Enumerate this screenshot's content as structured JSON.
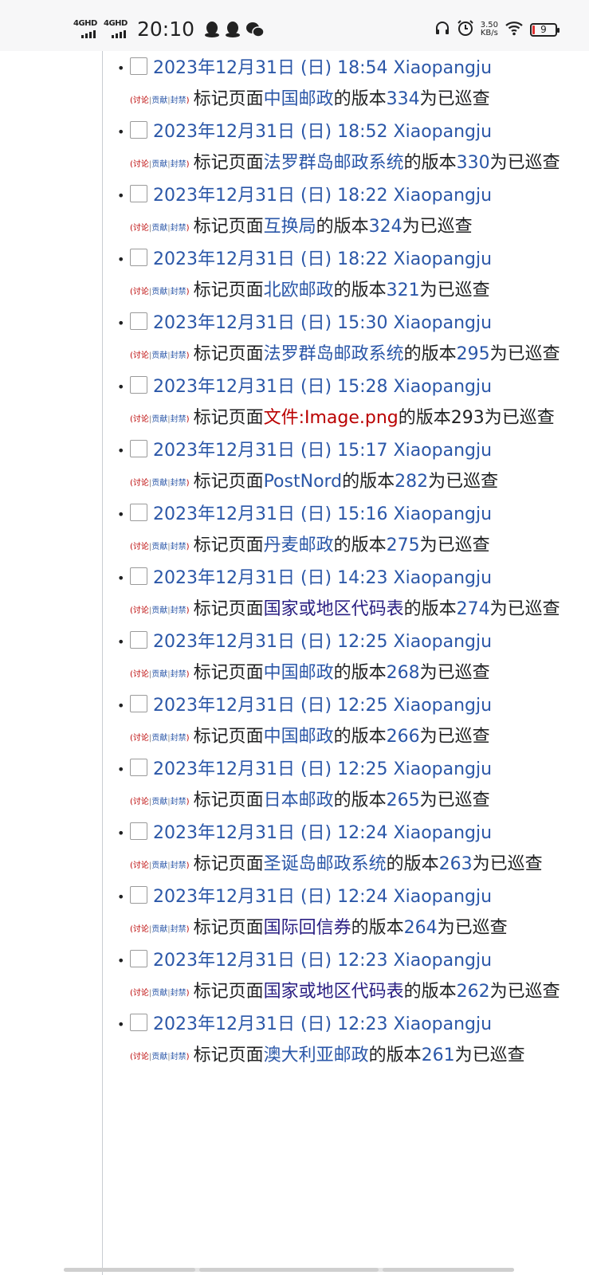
{
  "status_bar": {
    "signal1_label": "4GHD",
    "signal2_label": "4GHD",
    "time": "20:10",
    "notification_icons": [
      "qq-penguin-icon",
      "qq-penguin-icon",
      "wechat-icon"
    ],
    "net_speed_value": "3.50",
    "net_speed_unit": "KB/s",
    "battery_level": "9"
  },
  "tools": {
    "open": "(",
    "talk": "讨论",
    "sep": "|",
    "contribs": "贡献",
    "block": "封禁",
    "close": ")"
  },
  "checkbox_icon": "checkbox-icon",
  "bullet": "•",
  "entries": [
    {
      "time": "2023年12月31日 (日) 18:54",
      "user": "Xiaopangju",
      "pre": "标记页面",
      "page": "中国邮政",
      "mid": "的版本",
      "rev": "334",
      "post": "为已巡查"
    },
    {
      "time": "2023年12月31日 (日) 18:52",
      "user": "Xiaopangju",
      "pre": "标记页面",
      "page": "法罗群岛邮政系统",
      "mid": "的版本",
      "rev": "330",
      "post": "为已巡查"
    },
    {
      "time": "2023年12月31日 (日) 18:22",
      "user": "Xiaopangju",
      "pre": "标记页面",
      "page": "互换局",
      "mid": "的版本",
      "rev": "324",
      "post": "为已巡查"
    },
    {
      "time": "2023年12月31日 (日) 18:22",
      "user": "Xiaopangju",
      "pre": "标记页面",
      "page": "北欧邮政",
      "mid": "的版本",
      "rev": "321",
      "post": "为已巡查"
    },
    {
      "time": "2023年12月31日 (日) 15:30",
      "user": "Xiaopangju",
      "pre": "标记页面",
      "page": "法罗群岛邮政系统",
      "mid": "的版本",
      "rev": "295",
      "post": "为已巡查"
    },
    {
      "time": "2023年12月31日 (日) 15:28",
      "user": "Xiaopangju",
      "pre": "标记页面",
      "page": "文件:Image.png",
      "mid": "的版本",
      "rev": "293",
      "post": "为已巡查"
    },
    {
      "time": "2023年12月31日 (日) 15:17",
      "user": "Xiaopangju",
      "pre": "标记页面",
      "page": "PostNord",
      "mid": "的版本",
      "rev": "282",
      "post": "为已巡查"
    },
    {
      "time": "2023年12月31日 (日) 15:16",
      "user": "Xiaopangju",
      "pre": "标记页面",
      "page": "丹麦邮政",
      "mid": "的版本",
      "rev": "275",
      "post": "为已巡查"
    },
    {
      "time": "2023年12月31日 (日) 14:23",
      "user": "Xiaopangju",
      "pre": "标记页面",
      "page": "国家或地区代码表",
      "mid": "的版本",
      "rev": "274",
      "post": "为已巡查"
    },
    {
      "time": "2023年12月31日 (日) 12:25",
      "user": "Xiaopangju",
      "pre": "标记页面",
      "page": "中国邮政",
      "mid": "的版本",
      "rev": "268",
      "post": "为已巡查"
    },
    {
      "time": "2023年12月31日 (日) 12:25",
      "user": "Xiaopangju",
      "pre": "标记页面",
      "page": "中国邮政",
      "mid": "的版本",
      "rev": "266",
      "post": "为已巡查"
    },
    {
      "time": "2023年12月31日 (日) 12:25",
      "user": "Xiaopangju",
      "pre": "标记页面",
      "page": "日本邮政",
      "mid": "的版本",
      "rev": "265",
      "post": "为已巡查"
    },
    {
      "time": "2023年12月31日 (日) 12:24",
      "user": "Xiaopangju",
      "pre": "标记页面",
      "page": "圣诞岛邮政系统",
      "mid": "的版本",
      "rev": "263",
      "post": "为已巡查"
    },
    {
      "time": "2023年12月31日 (日) 12:24",
      "user": "Xiaopangju",
      "pre": "标记页面",
      "page": "国际回信券",
      "mid": "的版本",
      "rev": "264",
      "post": "为已巡查"
    },
    {
      "time": "2023年12月31日 (日) 12:23",
      "user": "Xiaopangju",
      "pre": "标记页面",
      "page": "国家或地区代码表",
      "mid": "的版本",
      "rev": "262",
      "post": "为已巡查"
    },
    {
      "time": "2023年12月31日 (日) 12:23",
      "user": "Xiaopangju",
      "pre": "标记页面",
      "page": "澳大利亚邮政",
      "mid": "的版本",
      "rev": "261",
      "post": "为已巡查"
    }
  ]
}
